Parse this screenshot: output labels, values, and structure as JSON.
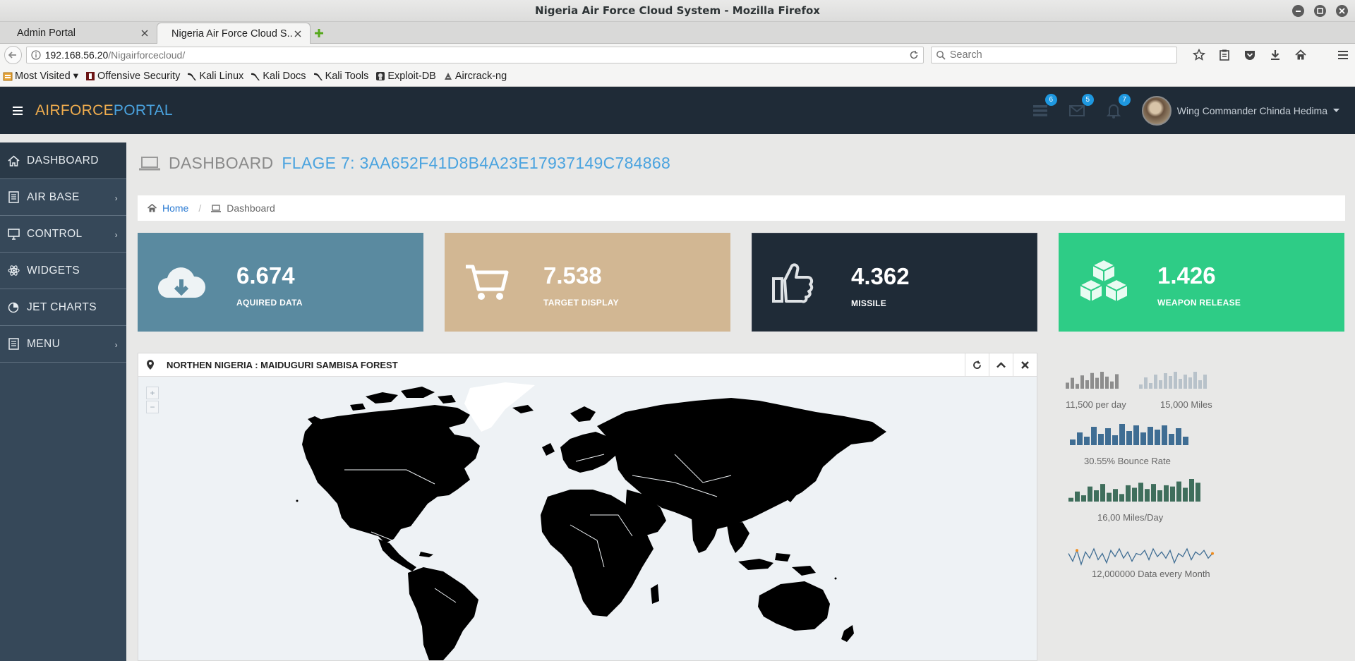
{
  "window": {
    "title": "Nigeria Air Force Cloud System - Mozilla Firefox"
  },
  "tabs": [
    {
      "label": "Admin Portal",
      "active": false
    },
    {
      "label": "Nigeria Air Force Cloud S...",
      "active": true
    }
  ],
  "address": {
    "host": "192.168.56.20",
    "path": "/Nigairforcecloud/"
  },
  "search": {
    "placeholder": "Search"
  },
  "bookmarks": [
    {
      "label": "Most Visited ▾",
      "icon": "folder-icon"
    },
    {
      "label": "Offensive Security",
      "icon": "offsec-icon"
    },
    {
      "label": "Kali Linux",
      "icon": "kali-icon"
    },
    {
      "label": "Kali Docs",
      "icon": "kali-icon"
    },
    {
      "label": "Kali Tools",
      "icon": "kali-icon"
    },
    {
      "label": "Exploit-DB",
      "icon": "exploitdb-icon"
    },
    {
      "label": "Aircrack-ng",
      "icon": "aircrack-icon"
    }
  ],
  "app": {
    "brand_a": "AIRFORCE",
    "brand_b": "PORTAL",
    "badges": {
      "tasks": "6",
      "messages": "5",
      "alerts": "7"
    },
    "user": "Wing Commander Chinda Hedima"
  },
  "sidebar": [
    {
      "label": "DASHBOARD",
      "icon": "home-icon"
    },
    {
      "label": "AIR BASE",
      "icon": "book-icon"
    },
    {
      "label": "CONTROL",
      "icon": "desktop-icon"
    },
    {
      "label": "WIDGETS",
      "icon": "atom-icon"
    },
    {
      "label": "JET CHARTS",
      "icon": "pie-chart-icon"
    },
    {
      "label": "MENU",
      "icon": "list-icon"
    }
  ],
  "page": {
    "title": "DASHBOARD",
    "flag": "FLAGE 7: 3AA652F41D8B4A23E17937149C784868"
  },
  "breadcrumb": {
    "home": "Home",
    "current": "Dashboard"
  },
  "stats": [
    {
      "value": "6.674",
      "label": "AQUIRED DATA",
      "icon": "cloud-download-icon",
      "color": "#5a8aa0"
    },
    {
      "value": "7.538",
      "label": "TARGET DISPLAY",
      "icon": "cart-icon",
      "color": "#d2b793"
    },
    {
      "value": "4.362",
      "label": "MISSILE",
      "icon": "thumbs-up-icon",
      "color": "#1f2b37"
    },
    {
      "value": "1.426",
      "label": "WEAPON RELEASE",
      "icon": "cubes-icon",
      "color": "#2ecc86"
    }
  ],
  "map": {
    "title": "NORTHEN NIGERIA : MAIDUGURI SAMBISA FOREST"
  },
  "sparklines": {
    "bars_a": [
      5,
      9,
      4,
      11,
      7,
      13,
      9,
      14,
      10,
      6,
      12
    ],
    "bars_b": [
      3,
      8,
      4,
      10,
      6,
      11,
      9,
      12,
      7,
      10,
      8,
      12,
      6,
      10
    ],
    "bars_c": [
      4,
      9,
      6,
      13,
      8,
      12,
      7,
      15,
      10,
      14,
      9,
      13,
      11,
      14,
      8,
      12,
      6
    ],
    "bars_d": [
      3,
      8,
      5,
      12,
      9,
      14,
      7,
      10,
      6,
      13,
      11,
      15,
      10,
      14,
      9,
      13,
      12,
      16,
      11,
      18,
      15
    ],
    "line": [
      12,
      7,
      14,
      5,
      13,
      9,
      15,
      8,
      12,
      6,
      14,
      10,
      15,
      9,
      13,
      7,
      12,
      11,
      14,
      8,
      15,
      10,
      13,
      9,
      14,
      6,
      12,
      10,
      15,
      8,
      13,
      11,
      14,
      9,
      12
    ],
    "captions": {
      "a": "11,500 per day",
      "b": "15,000 Miles",
      "c": "30.55% Bounce Rate",
      "d": "16,00 Miles/Day",
      "e": "12,000000 Data every Month"
    },
    "colors": {
      "grey": "#8d8d8d",
      "lightgrey": "#b8c2ca",
      "blue": "#3f6d93",
      "green": "#3f6e5c",
      "line": "#3f6d93",
      "dot": "#f08c1e"
    }
  }
}
